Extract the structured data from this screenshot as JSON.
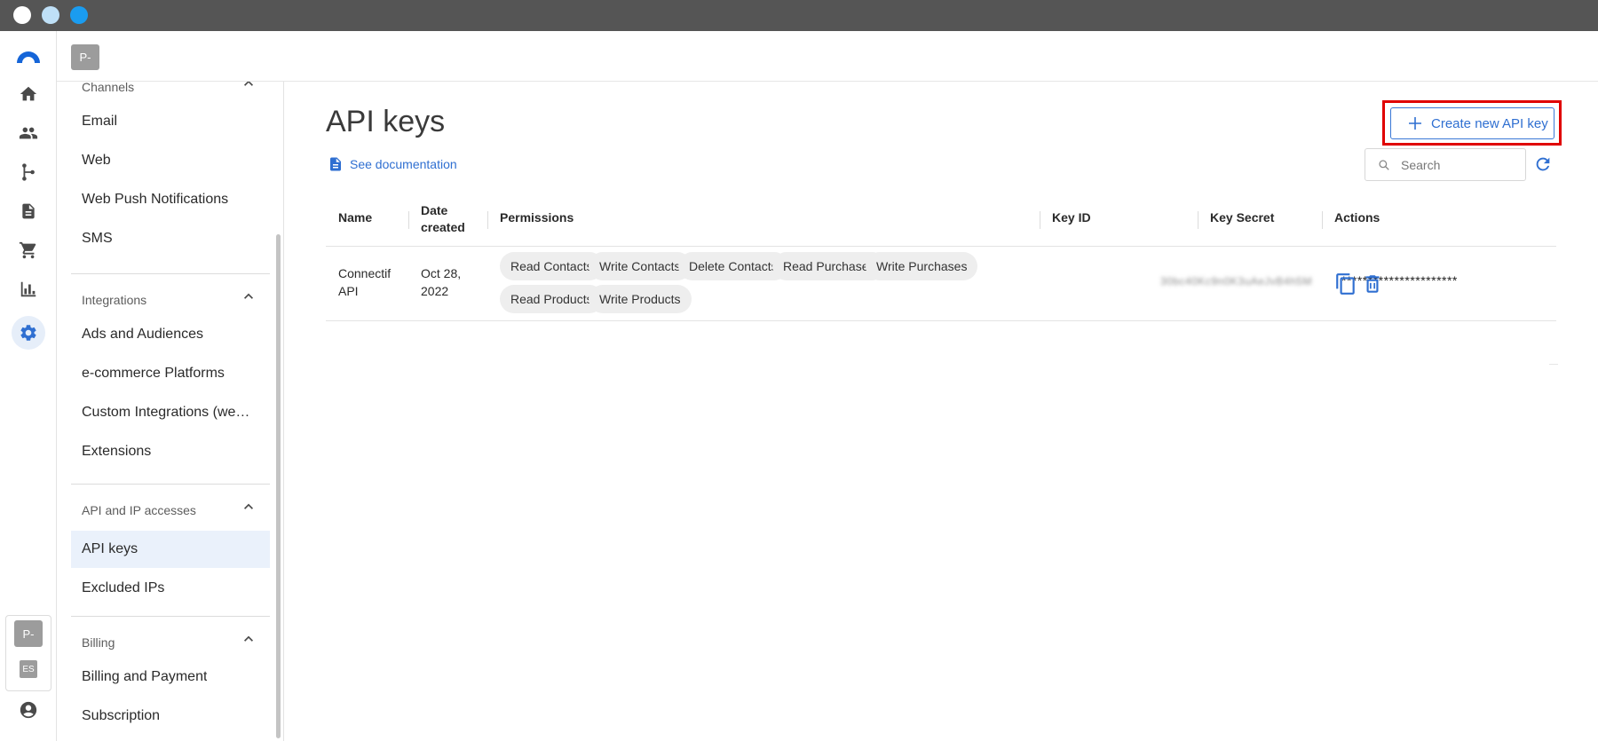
{
  "colors": {
    "accent": "#2f6fd1",
    "highlight_border": "#e00000",
    "titlebar": "#555555"
  },
  "window": {
    "dots": [
      {
        "name": "close-dot",
        "color": "#ffffff"
      },
      {
        "name": "minimize-dot",
        "color": "#bfe0f7"
      },
      {
        "name": "maximize-dot",
        "color": "#1a9cf0"
      }
    ]
  },
  "rail": {
    "items": [
      "logo-icon",
      "home-icon",
      "contacts-icon",
      "automation-icon",
      "templates-icon",
      "cart-icon",
      "reports-icon",
      "ai-sparkle-icon",
      "settings-icon"
    ],
    "workspace_badge": "P-",
    "lang_badge": "ES",
    "account_icon": "account-icon"
  },
  "topbar": {
    "workspace_badge": "P-"
  },
  "sidebar": {
    "sections": [
      {
        "title": "Channels",
        "items": [
          "Email",
          "Web",
          "Web Push Notifications",
          "SMS"
        ]
      },
      {
        "title": "Integrations",
        "items": [
          "Ads and Audiences",
          "e-commerce Platforms",
          "Custom Integrations (webhooks)",
          "Extensions"
        ]
      },
      {
        "title": "API and IP accesses",
        "items": [
          "API keys",
          "Excluded IPs"
        ]
      },
      {
        "title": "Billing",
        "items": [
          "Billing and Payment",
          "Subscription"
        ]
      }
    ],
    "active_item": "API keys"
  },
  "main": {
    "title": "API keys",
    "doc_link": "See documentation",
    "create_button": "Create new API key",
    "search_placeholder": "Search",
    "table": {
      "headers": {
        "name": "Name",
        "date": "Date created",
        "permissions": "Permissions",
        "key_id": "Key ID",
        "key_secret": "Key Secret",
        "actions": "Actions"
      },
      "rows": [
        {
          "name": "Connectif API",
          "date": "Oct 28, 2022",
          "permissions": [
            "Read Contacts",
            "Write Contacts",
            "Delete Contacts",
            "Read Purchases",
            "Write Purchases",
            "Read Products",
            "Write Products"
          ],
          "key_id": "30bc40Kc9n0K3uAeJvB4h5M",
          "key_secret": "**********************"
        }
      ]
    }
  }
}
